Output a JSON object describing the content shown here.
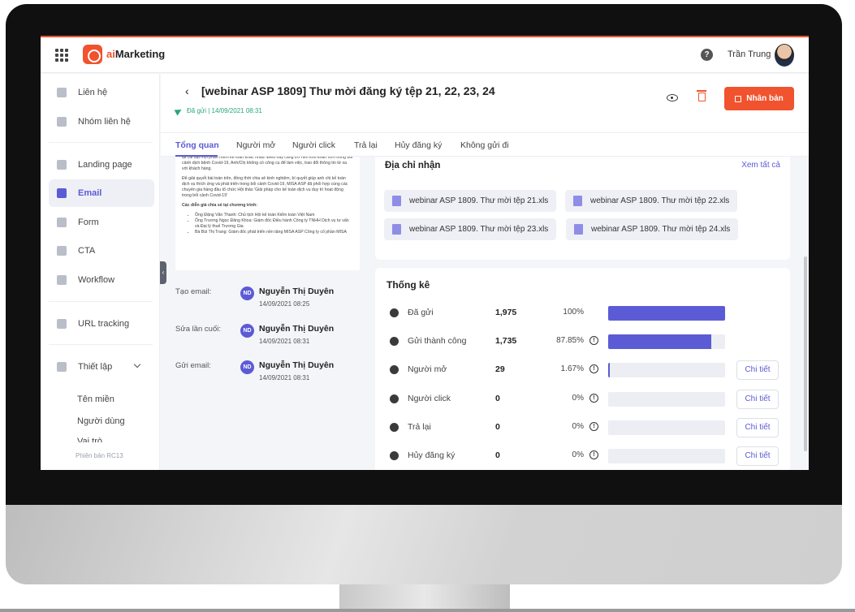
{
  "app": {
    "logo_ai": "ai",
    "logo_rest": "Marketing"
  },
  "topbar": {
    "help_icon": "?",
    "user_name": "Trần Trung"
  },
  "sidebar": {
    "items": [
      {
        "label": "Liên hệ",
        "icon": "contacts-icon"
      },
      {
        "label": "Nhóm liên hệ",
        "icon": "contact-group-icon"
      },
      {
        "label": "Landing page",
        "icon": "landing-page-icon"
      },
      {
        "label": "Email",
        "icon": "email-icon"
      },
      {
        "label": "Form",
        "icon": "form-icon"
      },
      {
        "label": "CTA",
        "icon": "cta-icon"
      },
      {
        "label": "Workflow",
        "icon": "workflow-icon"
      },
      {
        "label": "URL tracking",
        "icon": "link-icon"
      },
      {
        "label": "Thiết lập",
        "icon": "settings-icon"
      }
    ],
    "sub_items": [
      "Tên miền",
      "Người dùng",
      "Vai trò"
    ],
    "version": "Phiên bản RC13",
    "active": "Email"
  },
  "header": {
    "title": "[webinar ASP 1809] Thư mời đăng ký tệp 21, 22, 23, 24",
    "status": "Đã gửi | 14/09/2021 08:31",
    "clone_label": "Nhân bản"
  },
  "tabs": [
    "Tổng quan",
    "Người mở",
    "Người click",
    "Trả lại",
    "Hủy đăng ký",
    "Không gửi đi"
  ],
  "preview": {
    "p1": "lại cài đặt mọi phần mềm kế toán khác nhau. Điều này càng trở nên khó khăn hơn trong bối cảnh dịch bệnh Covid-19, Anh/Chị không có công cụ để làm việc, trao đổi thông tin từ xa với khách hàng.",
    "p2": "Để giải quyết bài toán trên, đồng thời chia sẻ kinh nghiệm, bí quyết giúp anh chị kế toán dịch vụ thích ứng và phát triển trong bối cảnh Covid-19, MISA ASP đã phối hợp cùng các chuyên gia hàng đầu tổ chức Hội thảo 'Giải pháp cho kế toán dịch vụ duy trì hoạt động trong bối cảnh Covid-19'",
    "p3": "Các diễn giả chia sẻ tại chương trình:",
    "speakers": [
      "Ông Đặng Văn Thanh: Chủ tịch Hội kế toán Kiểm toán Việt Nam",
      "Ông Trương Ngọc Đăng Khoa: Giám đốc Điều hành Công ty TNHH Dịch vụ tư vấn và Đại lý thuế Trương Gia",
      "Bà Bùi Thị Trang: Giám đốc phát triển nền tảng MISA ASP Công ty cổ phần MISA"
    ]
  },
  "meta": [
    {
      "label": "Tạo email:",
      "initials": "ND",
      "name": "Nguyễn Thị Duyên",
      "time": "14/09/2021 08:25"
    },
    {
      "label": "Sửa lần cuối:",
      "initials": "ND",
      "name": "Nguyễn Thị Duyên",
      "time": "14/09/2021 08:31"
    },
    {
      "label": "Gửi email:",
      "initials": "ND",
      "name": "Nguyễn Thị Duyên",
      "time": "14/09/2021 08:31"
    }
  ],
  "recipients": {
    "title": "Địa chỉ nhận",
    "see_all": "Xem tất cả",
    "files": [
      "webinar ASP 1809. Thư mời tệp 21.xls",
      "webinar ASP 1809. Thư mời tệp 22.xls",
      "webinar ASP 1809. Thư mời tệp 23.xls",
      "webinar ASP 1809. Thư mời tệp 24.xls"
    ]
  },
  "stats": {
    "title": "Thống kê",
    "detail_label": "Chi tiết",
    "rows": [
      {
        "label": "Đã gửi",
        "value": "1,975",
        "pct": "100%",
        "fraction": 1.0,
        "info": false,
        "detail": false,
        "icon": "send-icon"
      },
      {
        "label": "Gửi thành công",
        "value": "1,735",
        "pct": "87.85%",
        "fraction": 0.8785,
        "info": true,
        "detail": false,
        "icon": "success-icon"
      },
      {
        "label": "Người mở",
        "value": "29",
        "pct": "1.67%",
        "fraction": 0.0167,
        "info": true,
        "detail": true,
        "icon": "open-mail-icon"
      },
      {
        "label": "Người click",
        "value": "0",
        "pct": "0%",
        "fraction": 0,
        "info": true,
        "detail": true,
        "icon": "click-icon"
      },
      {
        "label": "Trả lại",
        "value": "0",
        "pct": "0%",
        "fraction": 0,
        "info": true,
        "detail": true,
        "icon": "reply-icon"
      },
      {
        "label": "Hủy đăng ký",
        "value": "0",
        "pct": "0%",
        "fraction": 0,
        "info": true,
        "detail": true,
        "icon": "unsubscribe-icon"
      }
    ]
  },
  "colors": {
    "accent": "#5b5bd6",
    "brand": "#f0532e",
    "success": "#2aa776"
  }
}
